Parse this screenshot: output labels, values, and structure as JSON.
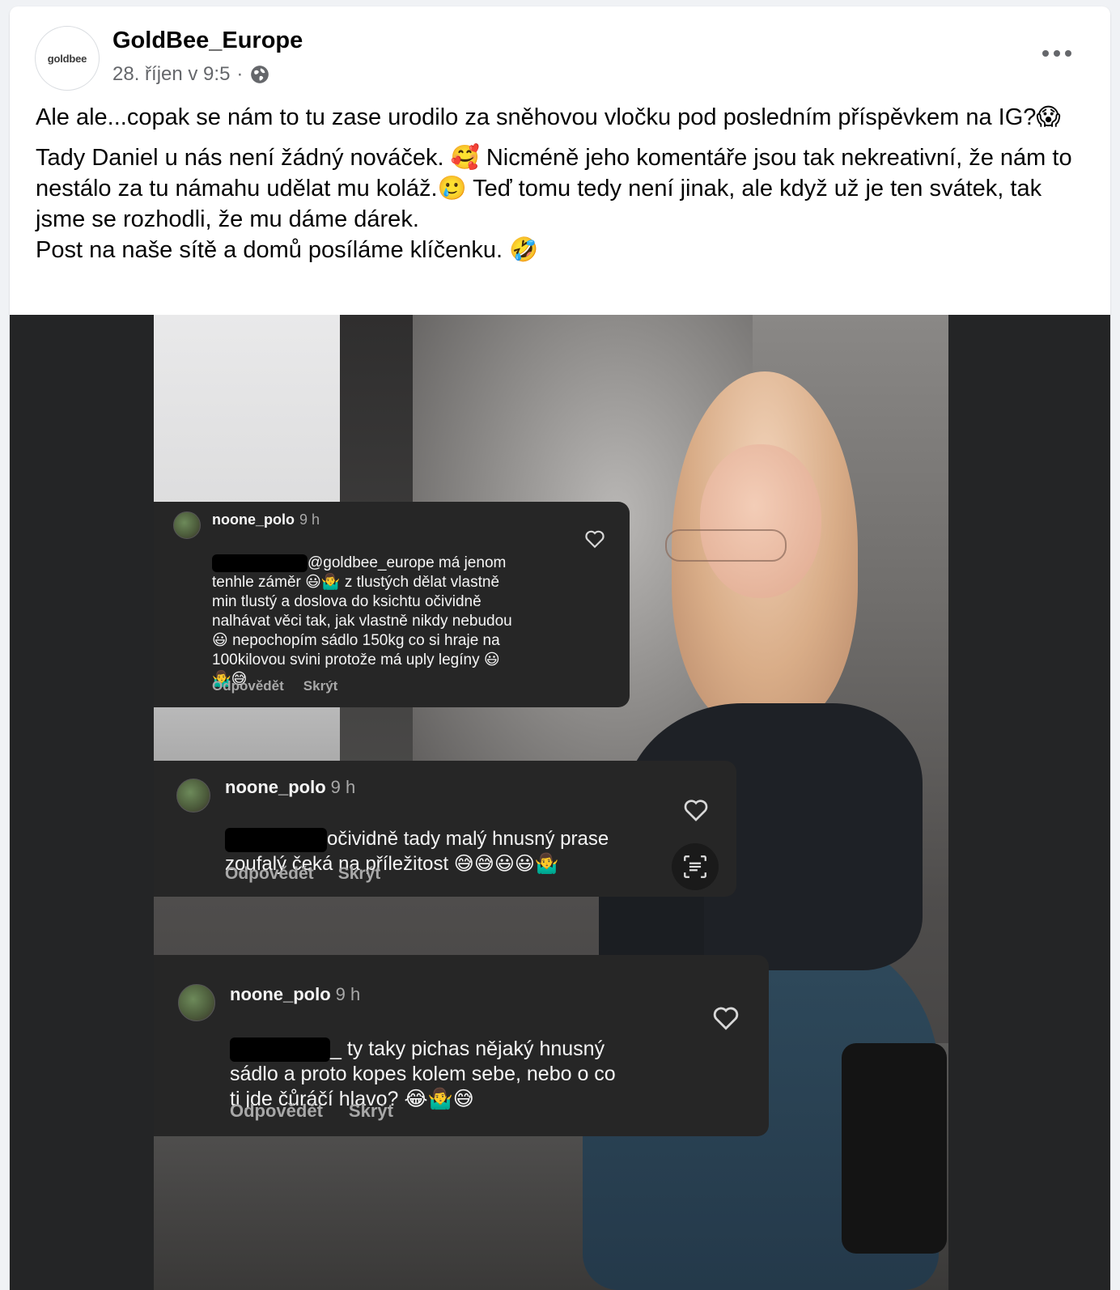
{
  "post": {
    "page_name": "GoldBee_Europe",
    "avatar_logo": "goldbee",
    "timestamp": "28. říjen v 9:5",
    "separator": "·",
    "privacy_icon": "globe-icon",
    "more_icon": "more-options-icon",
    "text": {
      "p1": "Ale ale...copak se nám to tu zase urodilo za sněhovou vločku pod posledním příspěvkem na IG?😱",
      "p2_line1": "Tady Daniel u nás není žádný nováček. 🥰 Nicméně jeho komentáře jsou tak nekreativní, že nám to nestálo za tu námahu udělat mu koláž.🥲 Teď tomu tedy není jinak, ale když už je ten svátek, tak jsme se rozhodli, že mu dáme dárek.",
      "p2_line2": "Post na naše sítě a domů posíláme klíčenku. 🤣"
    }
  },
  "comments": [
    {
      "username": "noone_polo",
      "time": "9 h",
      "text": "@goldbee_europe má jenom\ntenhle záměr 😃🤷‍♂️ z tlustých dělat vlastně\nmin tlustý a doslova do ksichtu očividně\nnalhávat věci tak, jak vlastně nikdy nebudou\n😃 nepochopím sádlo 150kg co si hraje na\n100kilovou svini protože má uply legíny 😃\n🤷‍♂️😅",
      "reply": "Odpovědět",
      "hide": "Skrýt"
    },
    {
      "username": "noone_polo",
      "time": "9 h",
      "text": "očividně tady malý hnusný prase\nzoufalý čeká na příležitost 😅😅😃😃🤷‍♂️",
      "reply": "Odpovědět",
      "hide": "Skrýt"
    },
    {
      "username": "noone_polo",
      "time": "9 h",
      "text": "_ ty taky pichas nějaký hnusný\nsádlo a proto kopes kolem sebe, nebo o co\nti jde čůráčí hlavo? 😂🤷‍♂️😅",
      "reply": "Odpovědět",
      "hide": "Skrýt"
    }
  ],
  "colors": {
    "page_bg": "#f0f2f5",
    "card_bg": "#ffffff",
    "secondary_text": "#65676b",
    "comment_bg": "#262626",
    "media_bg": "#242526"
  }
}
